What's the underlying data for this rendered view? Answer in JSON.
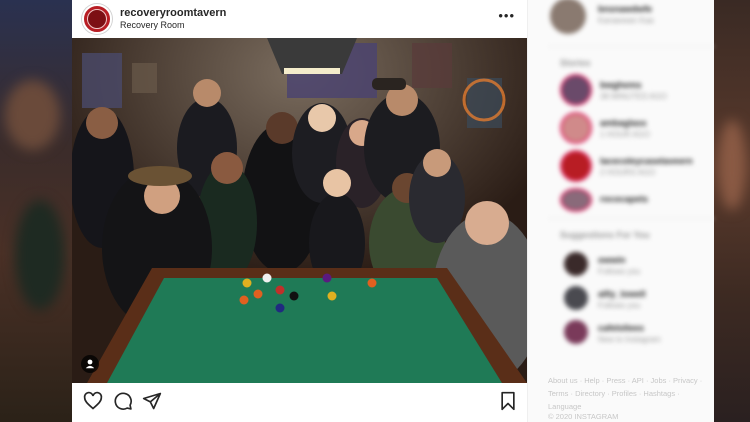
{
  "post": {
    "username": "recoveryroomtavern",
    "location": "Recovery Room",
    "more_icon": "more-horizontal-icon",
    "actions": [
      "heart-icon",
      "comment-icon",
      "share-icon",
      "bookmark-icon"
    ],
    "user_tag_icon": "user-tag-icon"
  },
  "sidebar": {
    "profile": {
      "name": "bnsnawdwfe",
      "sub": "Kanawwan Kaa"
    },
    "stories_heading": "Stories",
    "stories": [
      {
        "name": "bwghems",
        "sub": "38 MINUTES AGO"
      },
      {
        "name": "ambaglass",
        "sub": "1 HOUR AGO"
      },
      {
        "name": "lacecoleycasetaveern",
        "sub": "2 HOURS AGO"
      },
      {
        "name": "rococapets",
        "sub": "4 HOURS AGO"
      }
    ],
    "suggestions_heading": "Suggestions For You",
    "suggestions": [
      {
        "name": "owwin",
        "sub": "Follows you"
      },
      {
        "name": "allly_lowell",
        "sub": "Follows you"
      },
      {
        "name": "cafeloliees",
        "sub": "New to Instagram"
      }
    ],
    "footer": "About us · Help · Press · API · Jobs · Privacy · Terms · Directory · Profiles · Hashtags · Language",
    "copyright": "© 2020 INSTAGRAM"
  },
  "colors": {
    "brand": "#b81d24",
    "felt": "#1f7a56"
  }
}
